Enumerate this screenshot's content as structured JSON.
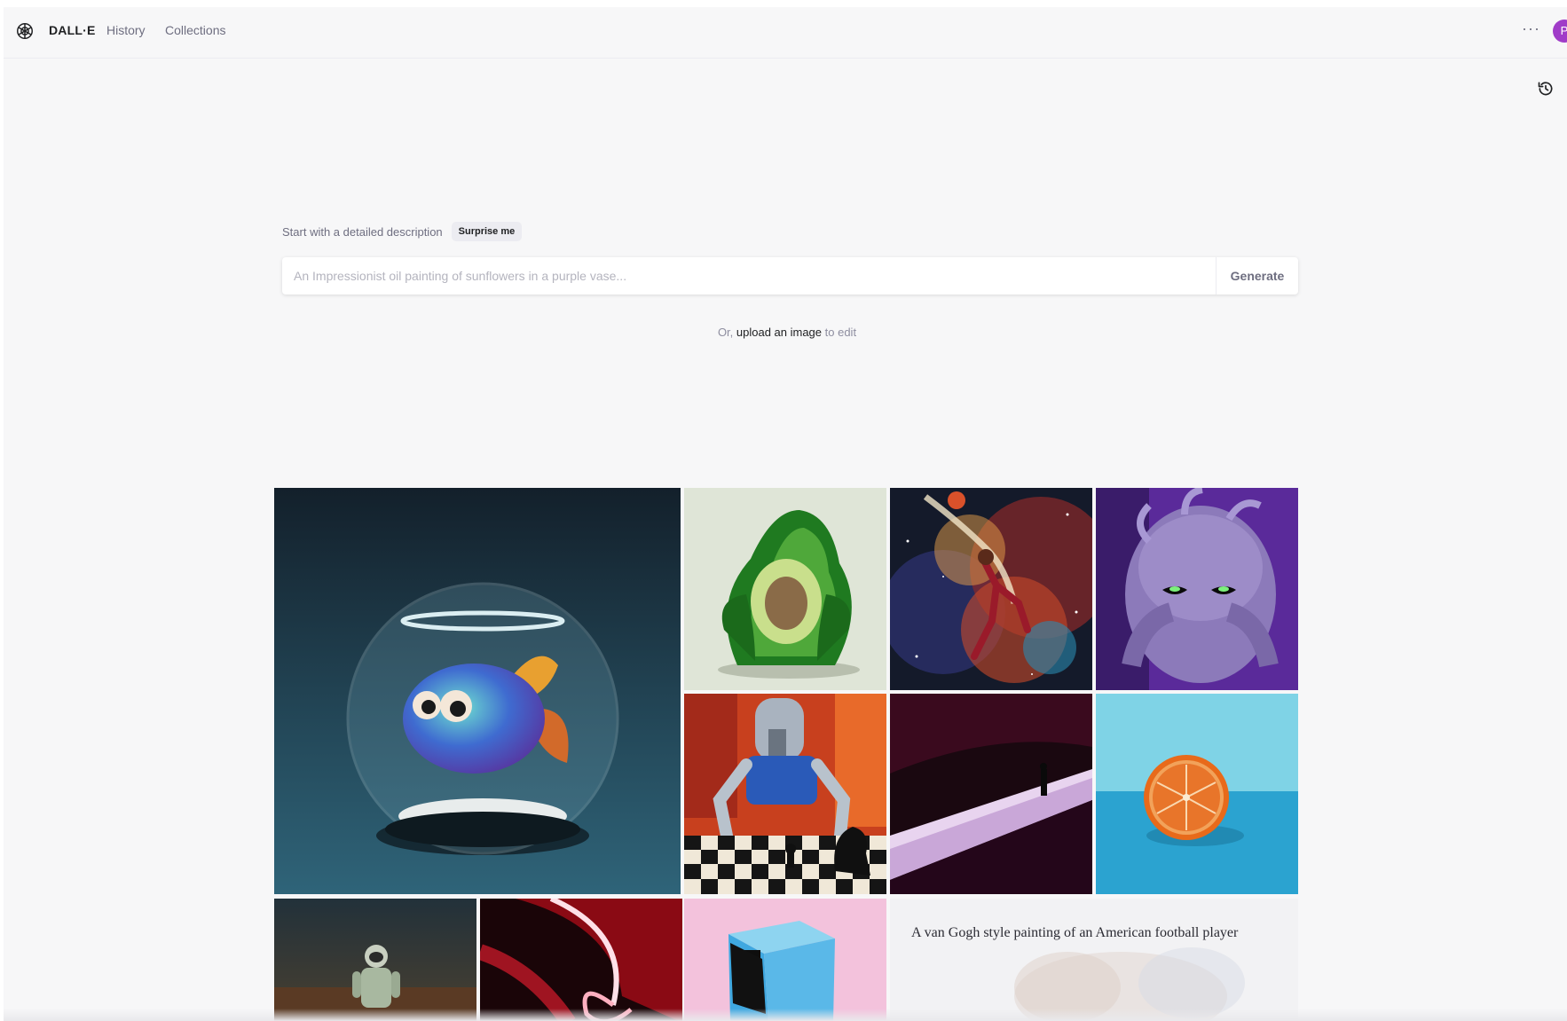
{
  "header": {
    "logo_icon": "openai-logo-icon",
    "brand": "DALL·E",
    "nav": [
      {
        "label": "History"
      },
      {
        "label": "Collections"
      }
    ],
    "more_label": "···",
    "avatar_initial": "P",
    "avatar_color": "#a03cc8"
  },
  "prompt": {
    "label": "Start with a detailed description",
    "surprise_label": "Surprise me",
    "placeholder": "An Impressionist oil painting of sunflowers in a purple vase...",
    "value": "",
    "generate_label": "Generate"
  },
  "upload": {
    "prefix": "Or, ",
    "link": "upload an image",
    "suffix": " to edit"
  },
  "gallery": {
    "items": [
      {
        "subject": "fish-bowl"
      },
      {
        "subject": "avocado-chair"
      },
      {
        "subject": "basketball-galaxy"
      },
      {
        "subject": "purple-monster"
      },
      {
        "subject": "robot-chess"
      },
      {
        "subject": "desert-figure"
      },
      {
        "subject": "orange-half"
      },
      {
        "subject": "astronaut"
      },
      {
        "subject": "neon-shape"
      },
      {
        "subject": "blue-box"
      },
      {
        "subject": "football-painting"
      }
    ],
    "hover_caption": "A van Gogh style painting of an American football player"
  },
  "colors": {
    "background": "#f7f7f8",
    "text": "#202123",
    "muted": "#6e6e80"
  }
}
